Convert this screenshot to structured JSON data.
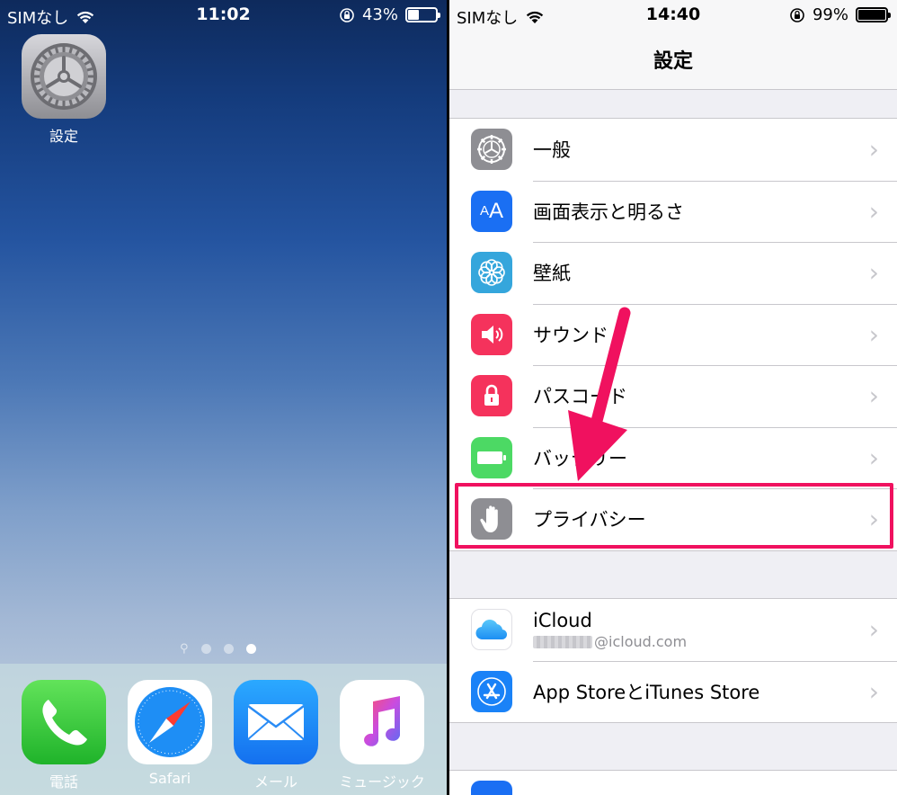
{
  "left_screen": {
    "status": {
      "carrier": "SIMなし",
      "time": "11:02",
      "battery_pct": "43%",
      "battery_level": 0.43
    },
    "apps": [
      {
        "label": "設定",
        "icon": "settings-gear-icon"
      }
    ],
    "page_dots": {
      "count": 3,
      "active": 3
    },
    "dock": [
      {
        "label": "電話",
        "icon": "phone-icon"
      },
      {
        "label": "Safari",
        "icon": "compass-icon"
      },
      {
        "label": "メール",
        "icon": "mail-envelope-icon"
      },
      {
        "label": "ミュージック",
        "icon": "music-note-icon"
      }
    ]
  },
  "right_screen": {
    "status": {
      "carrier": "SIMなし",
      "time": "14:40",
      "battery_pct": "99%",
      "battery_level": 0.99
    },
    "title": "設定",
    "group1": [
      {
        "label": "一般",
        "icon": "gear-icon",
        "color": "#8e8e93"
      },
      {
        "label": "画面表示と明るさ",
        "icon": "text-size-icon",
        "color": "#1a6ff3"
      },
      {
        "label": "壁紙",
        "icon": "flower-icon",
        "color": "#35a6dc"
      },
      {
        "label": "サウンド",
        "icon": "speaker-icon",
        "color": "#f5325c"
      },
      {
        "label": "パスコード",
        "icon": "lock-icon",
        "color": "#f5325c"
      },
      {
        "label": "バッテリー",
        "icon": "battery-icon",
        "color": "#4cd964"
      },
      {
        "label": "プライバシー",
        "icon": "hand-icon",
        "color": "#8e8e93"
      }
    ],
    "group2": [
      {
        "label": "iCloud",
        "sub": "@icloud.com",
        "icon": "cloud-icon"
      },
      {
        "label": "App StoreとiTunes Store",
        "icon": "app-store-icon",
        "color": "#1a82f7"
      }
    ],
    "highlight_color": "#f0115f"
  }
}
